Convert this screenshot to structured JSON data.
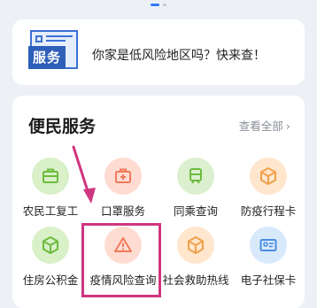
{
  "banner": {
    "icon_label": "服务",
    "text": "你家是低风险地区吗？快来查！"
  },
  "card": {
    "title": "便民服务",
    "view_all": "查看全部",
    "items": [
      {
        "label": "农民工复工",
        "icon": "briefcase-icon",
        "color": "#d9f0c8"
      },
      {
        "label": "口罩服务",
        "icon": "medical-kit-icon",
        "color": "#ffdcd2"
      },
      {
        "label": "同乘查询",
        "icon": "train-icon",
        "color": "#dcf0d0"
      },
      {
        "label": "防疫行程卡",
        "icon": "cube-icon",
        "color": "#ffe6cd"
      },
      {
        "label": "住房公积金",
        "icon": "cube-icon",
        "color": "#d9f0c8"
      },
      {
        "label": "疫情风险查询",
        "icon": "warning-icon",
        "color": "#ffdcd2"
      },
      {
        "label": "社会救助热线",
        "icon": "cube-icon",
        "color": "#ffe6cd"
      },
      {
        "label": "电子社保卡",
        "icon": "id-card-icon",
        "color": "#d8e9fb"
      }
    ]
  }
}
